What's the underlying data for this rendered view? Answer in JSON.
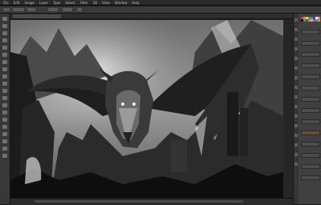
{
  "menu": {
    "items": [
      "File",
      "Edit",
      "Image",
      "Layer",
      "Type",
      "Select",
      "Filter",
      "3D",
      "View",
      "Window",
      "Help"
    ]
  },
  "palette": {
    "swatches": [
      "#e53935",
      "#fb8c00",
      "#fdd835",
      "#43a047",
      "#1e88e5",
      "#8e24aa",
      "#ffffff",
      "#9e9e9e",
      "#000000",
      "#00acc1",
      "#6d4c41",
      "#f06292",
      "#c0ca33",
      "#5c6bc0",
      "#26a69a",
      "#ff7043"
    ]
  },
  "colors": {
    "accent": "#6a4a3a",
    "background": "#1a1a1a"
  }
}
